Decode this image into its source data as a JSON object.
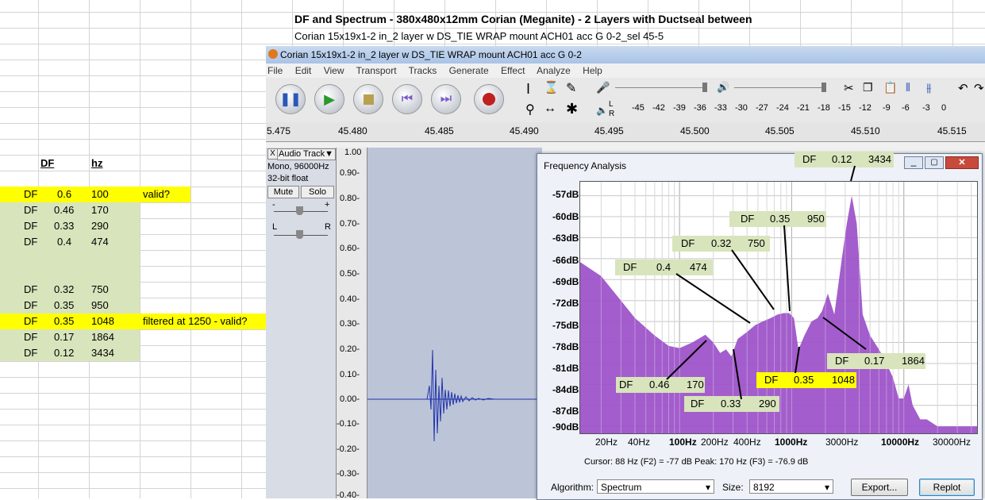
{
  "title": "DF and Spectrum - 380x480x12mm Corian (Meganite) - 2 Layers with Ductseal between",
  "subtitle": "Corian 15x19x1-2 in_2 layer w DS_TIE WRAP mount ACH01 acc G 0-2_sel 45-5",
  "sheet": {
    "col_df": "DF",
    "col_hz": "hz",
    "rows": [
      {
        "label": "DF",
        "df": "0.6",
        "hz": "100",
        "note": "valid?",
        "hl": "yellow"
      },
      {
        "label": "DF",
        "df": "0.46",
        "hz": "170",
        "note": "",
        "hl": "green"
      },
      {
        "label": "DF",
        "df": "0.33",
        "hz": "290",
        "note": "",
        "hl": "green"
      },
      {
        "label": "DF",
        "df": "0.4",
        "hz": "474",
        "note": "",
        "hl": "green"
      },
      {
        "label": "DF",
        "df": "0.32",
        "hz": "750",
        "note": "",
        "hl": "green"
      },
      {
        "label": "DF",
        "df": "0.35",
        "hz": "950",
        "note": "",
        "hl": "green"
      },
      {
        "label": "DF",
        "df": "0.35",
        "hz": "1048",
        "note": "filtered at 1250 - valid?",
        "hl": "yellow"
      },
      {
        "label": "DF",
        "df": "0.17",
        "hz": "1864",
        "note": "",
        "hl": "green"
      },
      {
        "label": "DF",
        "df": "0.12",
        "hz": "3434",
        "note": "",
        "hl": "green"
      }
    ]
  },
  "audacity": {
    "window_title": "Corian 15x19x1-2 in_2 layer w DS_TIE WRAP mount ACH01 acc G 0-2",
    "menu": [
      "File",
      "Edit",
      "View",
      "Transport",
      "Tracks",
      "Generate",
      "Effect",
      "Analyze",
      "Help"
    ],
    "meter_ticks": [
      "-45",
      "-42",
      "-39",
      "-36",
      "-33",
      "-30",
      "-27",
      "-24",
      "-21",
      "-18",
      "-15",
      "-12",
      "-9",
      "-6",
      "-3",
      "0"
    ],
    "meter_lr": {
      "l": "L",
      "r": "R"
    },
    "ruler": [
      "5.475",
      "45.480",
      "45.485",
      "45.490",
      "45.495",
      "45.500",
      "45.505",
      "45.510",
      "45.515"
    ],
    "track": {
      "name": "Audio Track",
      "format": "Mono, 96000Hz",
      "bits": "32-bit float",
      "mute": "Mute",
      "solo": "Solo",
      "pan_l": "L",
      "pan_r": "R",
      "gain_minus": "-",
      "gain_plus": "+",
      "close": "X"
    },
    "amp_ticks": [
      "1.00",
      "0.90-",
      "0.80-",
      "0.70-",
      "0.60-",
      "0.50-",
      "0.40-",
      "0.30-",
      "0.20-",
      "0.10-",
      "0.00-",
      "-0.10-",
      "-0.20-",
      "-0.30-",
      "-0.40-"
    ]
  },
  "freq": {
    "title": "Frequency Analysis",
    "y_ticks": [
      "-57dB",
      "-60dB",
      "-63dB",
      "-66dB",
      "-69dB",
      "-72dB",
      "-75dB",
      "-78dB",
      "-81dB",
      "-84dB",
      "-87dB",
      "-90dB"
    ],
    "x_ticks": [
      "20Hz",
      "40Hz",
      "100Hz",
      "200Hz",
      "400Hz",
      "1000Hz",
      "3000Hz",
      "10000Hz",
      "30000Hz"
    ],
    "cursor": "Cursor: 88 Hz (F2) = -77 dB",
    "peak": "Peak: 170 Hz (F3) = -76.9 dB",
    "algorithm_label": "Algorithm:",
    "algorithm": "Spectrum",
    "size_label": "Size:",
    "size": "8192",
    "export": "Export...",
    "replot": "Replot",
    "fill": "#9b4fc8"
  },
  "chart_data": {
    "type": "area",
    "xlabel": "",
    "ylabel": "",
    "x_scale": "log",
    "xlim": [
      13,
      45000
    ],
    "ylim": [
      -91,
      -55
    ],
    "x": [
      13,
      20,
      30,
      40,
      60,
      80,
      100,
      130,
      170,
      200,
      230,
      260,
      290,
      330,
      400,
      474,
      550,
      650,
      750,
      850,
      950,
      1048,
      1150,
      1300,
      1500,
      1700,
      1864,
      2100,
      2400,
      2800,
      3100,
      3434,
      3800,
      4300,
      5000,
      6000,
      7000,
      8000,
      9000,
      10000,
      11000,
      12000,
      14000,
      16000,
      20000,
      30000,
      45000
    ],
    "y": [
      -66.5,
      -68.5,
      -72,
      -74.5,
      -77,
      -78.5,
      -78.8,
      -78,
      -76.9,
      -78,
      -79.5,
      -79,
      -80,
      -77.5,
      -76.5,
      -75.5,
      -75,
      -74.5,
      -74,
      -73.8,
      -73.8,
      -74.5,
      -79,
      -77,
      -75,
      -74.5,
      -73.5,
      -71,
      -74,
      -66,
      -61,
      -57,
      -61,
      -74,
      -77,
      -79,
      -81,
      -83,
      -86,
      -86,
      -84,
      -87,
      -89,
      -89,
      -90,
      -90,
      -90
    ],
    "annotations": [
      {
        "label": "DF",
        "df": "0.12",
        "hz": "3434",
        "hl": "green"
      },
      {
        "label": "DF",
        "df": "0.35",
        "hz": "950",
        "hl": "green"
      },
      {
        "label": "DF",
        "df": "0.32",
        "hz": "750",
        "hl": "green"
      },
      {
        "label": "DF",
        "df": "0.4",
        "hz": "474",
        "hl": "green"
      },
      {
        "label": "DF",
        "df": "0.17",
        "hz": "1864",
        "hl": "green"
      },
      {
        "label": "DF",
        "df": "0.35",
        "hz": "1048",
        "hl": "yellow"
      },
      {
        "label": "DF",
        "df": "0.46",
        "hz": "170",
        "hl": "green"
      },
      {
        "label": "DF",
        "df": "0.33",
        "hz": "290",
        "hl": "green"
      }
    ]
  }
}
